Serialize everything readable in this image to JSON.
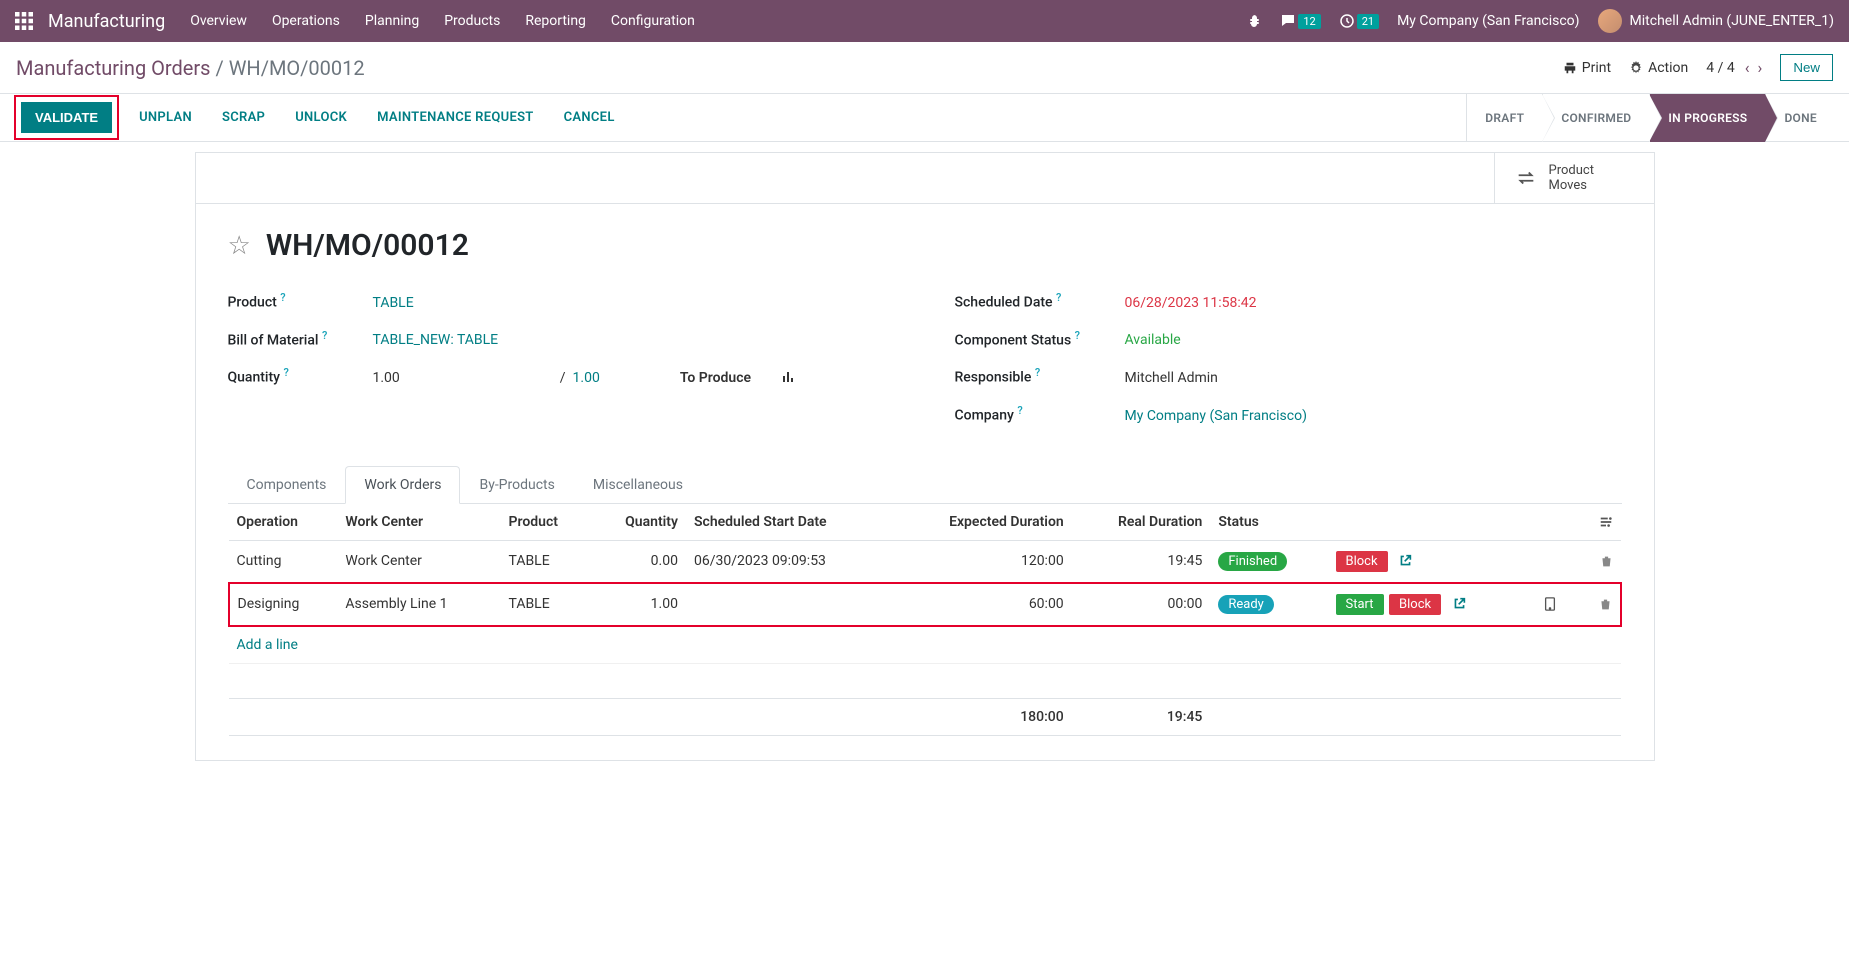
{
  "navbar": {
    "brand": "Manufacturing",
    "items": [
      "Overview",
      "Operations",
      "Planning",
      "Products",
      "Reporting",
      "Configuration"
    ],
    "messages_count": "12",
    "activities_count": "21",
    "company": "My Company (San Francisco)",
    "user": "Mitchell Admin (JUNE_ENTER_1)"
  },
  "breadcrumb": {
    "parent": "Manufacturing Orders",
    "current": "WH/MO/00012"
  },
  "cp": {
    "print": "Print",
    "action": "Action",
    "pager": "4 / 4",
    "new": "New"
  },
  "actions": {
    "validate": "VALIDATE",
    "unplan": "UNPLAN",
    "scrap": "SCRAP",
    "unlock": "UNLOCK",
    "maintenance": "MAINTENANCE REQUEST",
    "cancel": "CANCEL"
  },
  "status_steps": [
    "DRAFT",
    "CONFIRMED",
    "IN PROGRESS",
    "DONE"
  ],
  "stat_button": {
    "line1": "Product",
    "line2": "Moves"
  },
  "title": "WH/MO/00012",
  "fields": {
    "product_label": "Product",
    "product_value": "TABLE",
    "bom_label": "Bill of Material",
    "bom_value": "TABLE_NEW: TABLE",
    "qty_label": "Quantity",
    "qty_value": "1.00",
    "qty_total": "1.00",
    "to_produce": "To Produce",
    "scheduled_label": "Scheduled Date",
    "scheduled_value": "06/28/2023 11:58:42",
    "comp_status_label": "Component Status",
    "comp_status_value": "Available",
    "responsible_label": "Responsible",
    "responsible_value": "Mitchell Admin",
    "company_label": "Company",
    "company_value": "My Company (San Francisco)"
  },
  "tabs": [
    "Components",
    "Work Orders",
    "By-Products",
    "Miscellaneous"
  ],
  "table": {
    "headers": {
      "operation": "Operation",
      "work_center": "Work Center",
      "product": "Product",
      "quantity": "Quantity",
      "scheduled": "Scheduled Start Date",
      "expected": "Expected Duration",
      "real": "Real Duration",
      "status": "Status"
    },
    "rows": [
      {
        "operation": "Cutting",
        "work_center": "Work Center",
        "product": "TABLE",
        "quantity": "0.00",
        "scheduled": "06/30/2023 09:09:53",
        "expected": "120:00",
        "real": "19:45",
        "status": "Finished",
        "status_class": "finished",
        "has_start": false
      },
      {
        "operation": "Designing",
        "work_center": "Assembly Line 1",
        "product": "TABLE",
        "quantity": "1.00",
        "scheduled": "",
        "expected": "60:00",
        "real": "00:00",
        "status": "Ready",
        "status_class": "ready",
        "has_start": true
      }
    ],
    "add_line": "Add a line",
    "totals": {
      "expected": "180:00",
      "real": "19:45"
    },
    "start_label": "Start",
    "block_label": "Block"
  }
}
